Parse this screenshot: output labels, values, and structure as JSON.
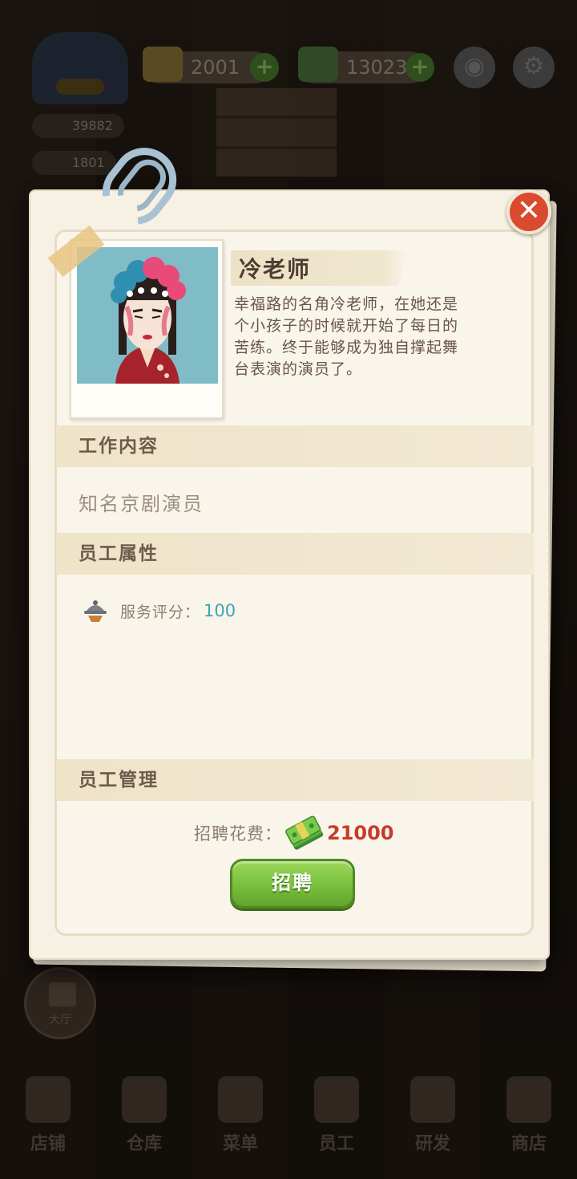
{
  "hud": {
    "ingredients": "2001",
    "cash": "130238",
    "stat_top": "39882",
    "stat_bottom": "1801",
    "hall_label": "大厅"
  },
  "bottom_nav": [
    "店铺",
    "仓库",
    "菜单",
    "员工",
    "研发",
    "商店"
  ],
  "modal": {
    "close_glyph": "✕",
    "name": "冷老师",
    "description": "幸福路的名角冷老师，在她还是个小孩子的时候就开始了每日的苦练。终于能够成为独自撑起舞台表演的演员了。",
    "job_header": "工作内容",
    "job_value": "知名京剧演员",
    "attr_header": "员工属性",
    "attr_label": "服务评分：",
    "attr_value": "100",
    "manage_header": "员工管理",
    "cost_label": "招聘花费：",
    "cost_value": "21000",
    "hire_button": "招聘"
  },
  "colors": {
    "accent_green": "#79bf3c",
    "cost_red": "#c73b2a",
    "attr_teal": "#3ea3b8",
    "close_red": "#d94a2e"
  }
}
